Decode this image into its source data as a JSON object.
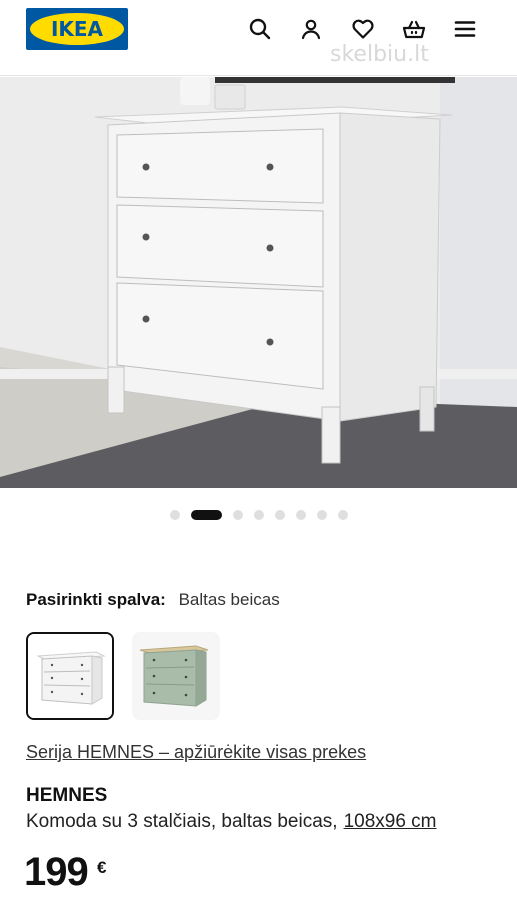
{
  "header": {
    "logo_text": "IKEA",
    "icons": [
      "search-icon",
      "user-icon",
      "heart-icon",
      "basket-icon",
      "menu-icon"
    ],
    "watermark": "skelbiu.lt"
  },
  "gallery": {
    "image_count": 8,
    "active_index": 1
  },
  "color_selector": {
    "label": "Pasirinkti spalva:",
    "value": "Baltas beicas",
    "swatches": [
      {
        "name": "Baltas beicas",
        "selected": true,
        "color": "#f4f4f4"
      },
      {
        "name": "Žalia",
        "selected": false,
        "color": "#a9bcaa"
      }
    ]
  },
  "product": {
    "series_link": "Serija HEMNES – apžiūrėkite visas prekes",
    "name": "HEMNES",
    "description": "Komoda su 3 stalčiais, baltas beicas,",
    "size": "108x96 cm",
    "price": "199",
    "currency": "€"
  },
  "colors": {
    "brand_blue": "#0058a3",
    "brand_yellow": "#ffdb00",
    "text": "#111111"
  }
}
